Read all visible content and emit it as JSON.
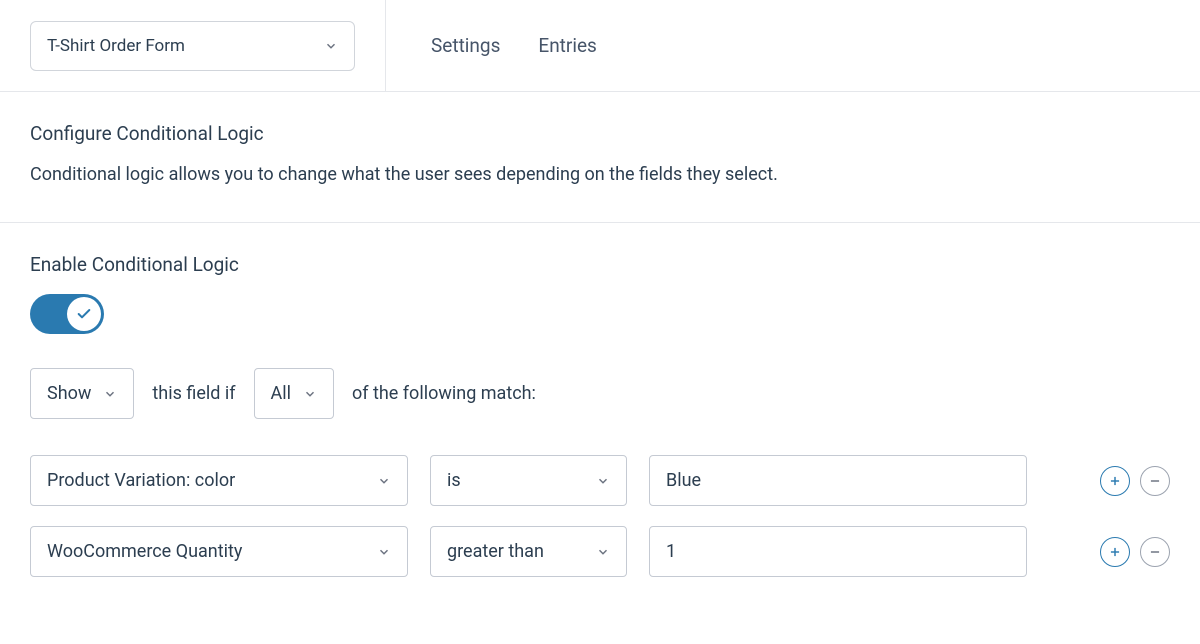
{
  "header": {
    "form_name": "T-Shirt Order Form",
    "tabs": {
      "settings": "Settings",
      "entries": "Entries"
    }
  },
  "intro": {
    "title": "Configure Conditional Logic",
    "description": "Conditional logic allows you to change what the user sees depending on the fields they select."
  },
  "enable": {
    "label": "Enable Conditional Logic",
    "on": true
  },
  "rule": {
    "action": "Show",
    "text_this_field_if": "this field if",
    "match_type": "All",
    "text_of_following": "of the following match:"
  },
  "conditions": [
    {
      "field": "Product Variation: color",
      "operator": "is",
      "value": "Blue"
    },
    {
      "field": "WooCommerce Quantity",
      "operator": "greater than",
      "value": "1"
    }
  ]
}
